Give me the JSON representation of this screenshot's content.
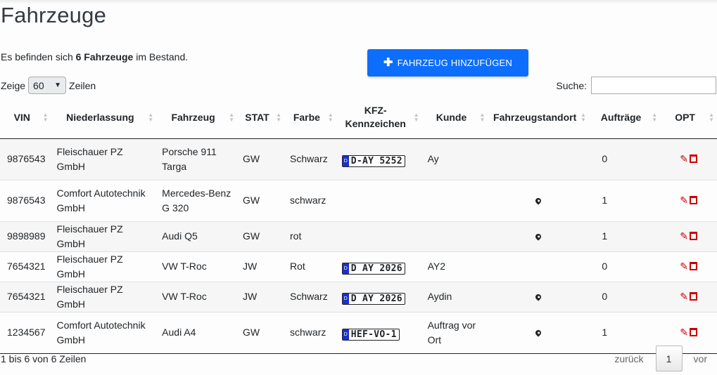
{
  "page": {
    "title": "Fahrzeuge",
    "summary_prefix": "Es befinden sich",
    "summary_count": "6 Fahrzeuge",
    "summary_suffix": "im Bestand.",
    "add_button": "FAHRZEUG HINZUFÜGEN"
  },
  "controls": {
    "show_label": "Zeige",
    "page_length": "60",
    "rows_label": "Zeilen",
    "search_label": "Suche:",
    "search_value": ""
  },
  "table": {
    "headers": {
      "vin": "VIN",
      "branch": "Niederlassung",
      "vehicle": "Fahrzeug",
      "stat": "STAT",
      "color": "Farbe",
      "plate_line1": "KFZ-",
      "plate_line2": "Kennzeichen",
      "customer": "Kunde",
      "location": "Fahrzeugstandort",
      "orders": "Aufträge",
      "opt": "OPT"
    },
    "rows": [
      {
        "vin": "9876543",
        "branch": "Fleischauer PZ GmbH",
        "vehicle": "Porsche 911 Targa",
        "stat": "GW",
        "color": "Schwarz",
        "plate": "D-AY 5252",
        "customer": "Ay",
        "orders": "0"
      },
      {
        "vin": "9876543",
        "branch": "Comfort Autotechnik GmbH",
        "vehicle": "Mercedes-Benz G 320",
        "stat": "GW",
        "color": "schwarz",
        "plate": "",
        "customer": "",
        "orders": "1"
      },
      {
        "vin": "9898989",
        "branch": "Fleischauer PZ GmbH",
        "vehicle": "Audi Q5",
        "stat": "GW",
        "color": "rot",
        "plate": "",
        "customer": "",
        "orders": "1"
      },
      {
        "vin": "7654321",
        "branch": "Fleischauer PZ GmbH",
        "vehicle": "VW T-Roc",
        "stat": "JW",
        "color": "Rot",
        "plate": "D AY 2026",
        "customer": "AY2",
        "orders": "0"
      },
      {
        "vin": "7654321",
        "branch": "Fleischauer PZ GmbH",
        "vehicle": "VW T-Roc",
        "stat": "JW",
        "color": "Schwarz",
        "plate": "D AY 2026",
        "customer": "Aydin",
        "orders": "0"
      },
      {
        "vin": "1234567",
        "branch": "Comfort Autotechnik GmbH",
        "vehicle": "Audi A4",
        "stat": "GW",
        "color": "schwarz",
        "plate": "HEF-VO-1",
        "customer": "Auftrag vor Ort",
        "orders": "1"
      }
    ]
  },
  "footer": {
    "info": "1 bis 6 von 6 Zeilen",
    "prev": "zurück",
    "current_page": "1",
    "next": "vor"
  },
  "plate_country": "D",
  "colors": {
    "primary": "#0d6efd",
    "danger": "#cc0000",
    "plate_blue": "#1c2fcc"
  }
}
